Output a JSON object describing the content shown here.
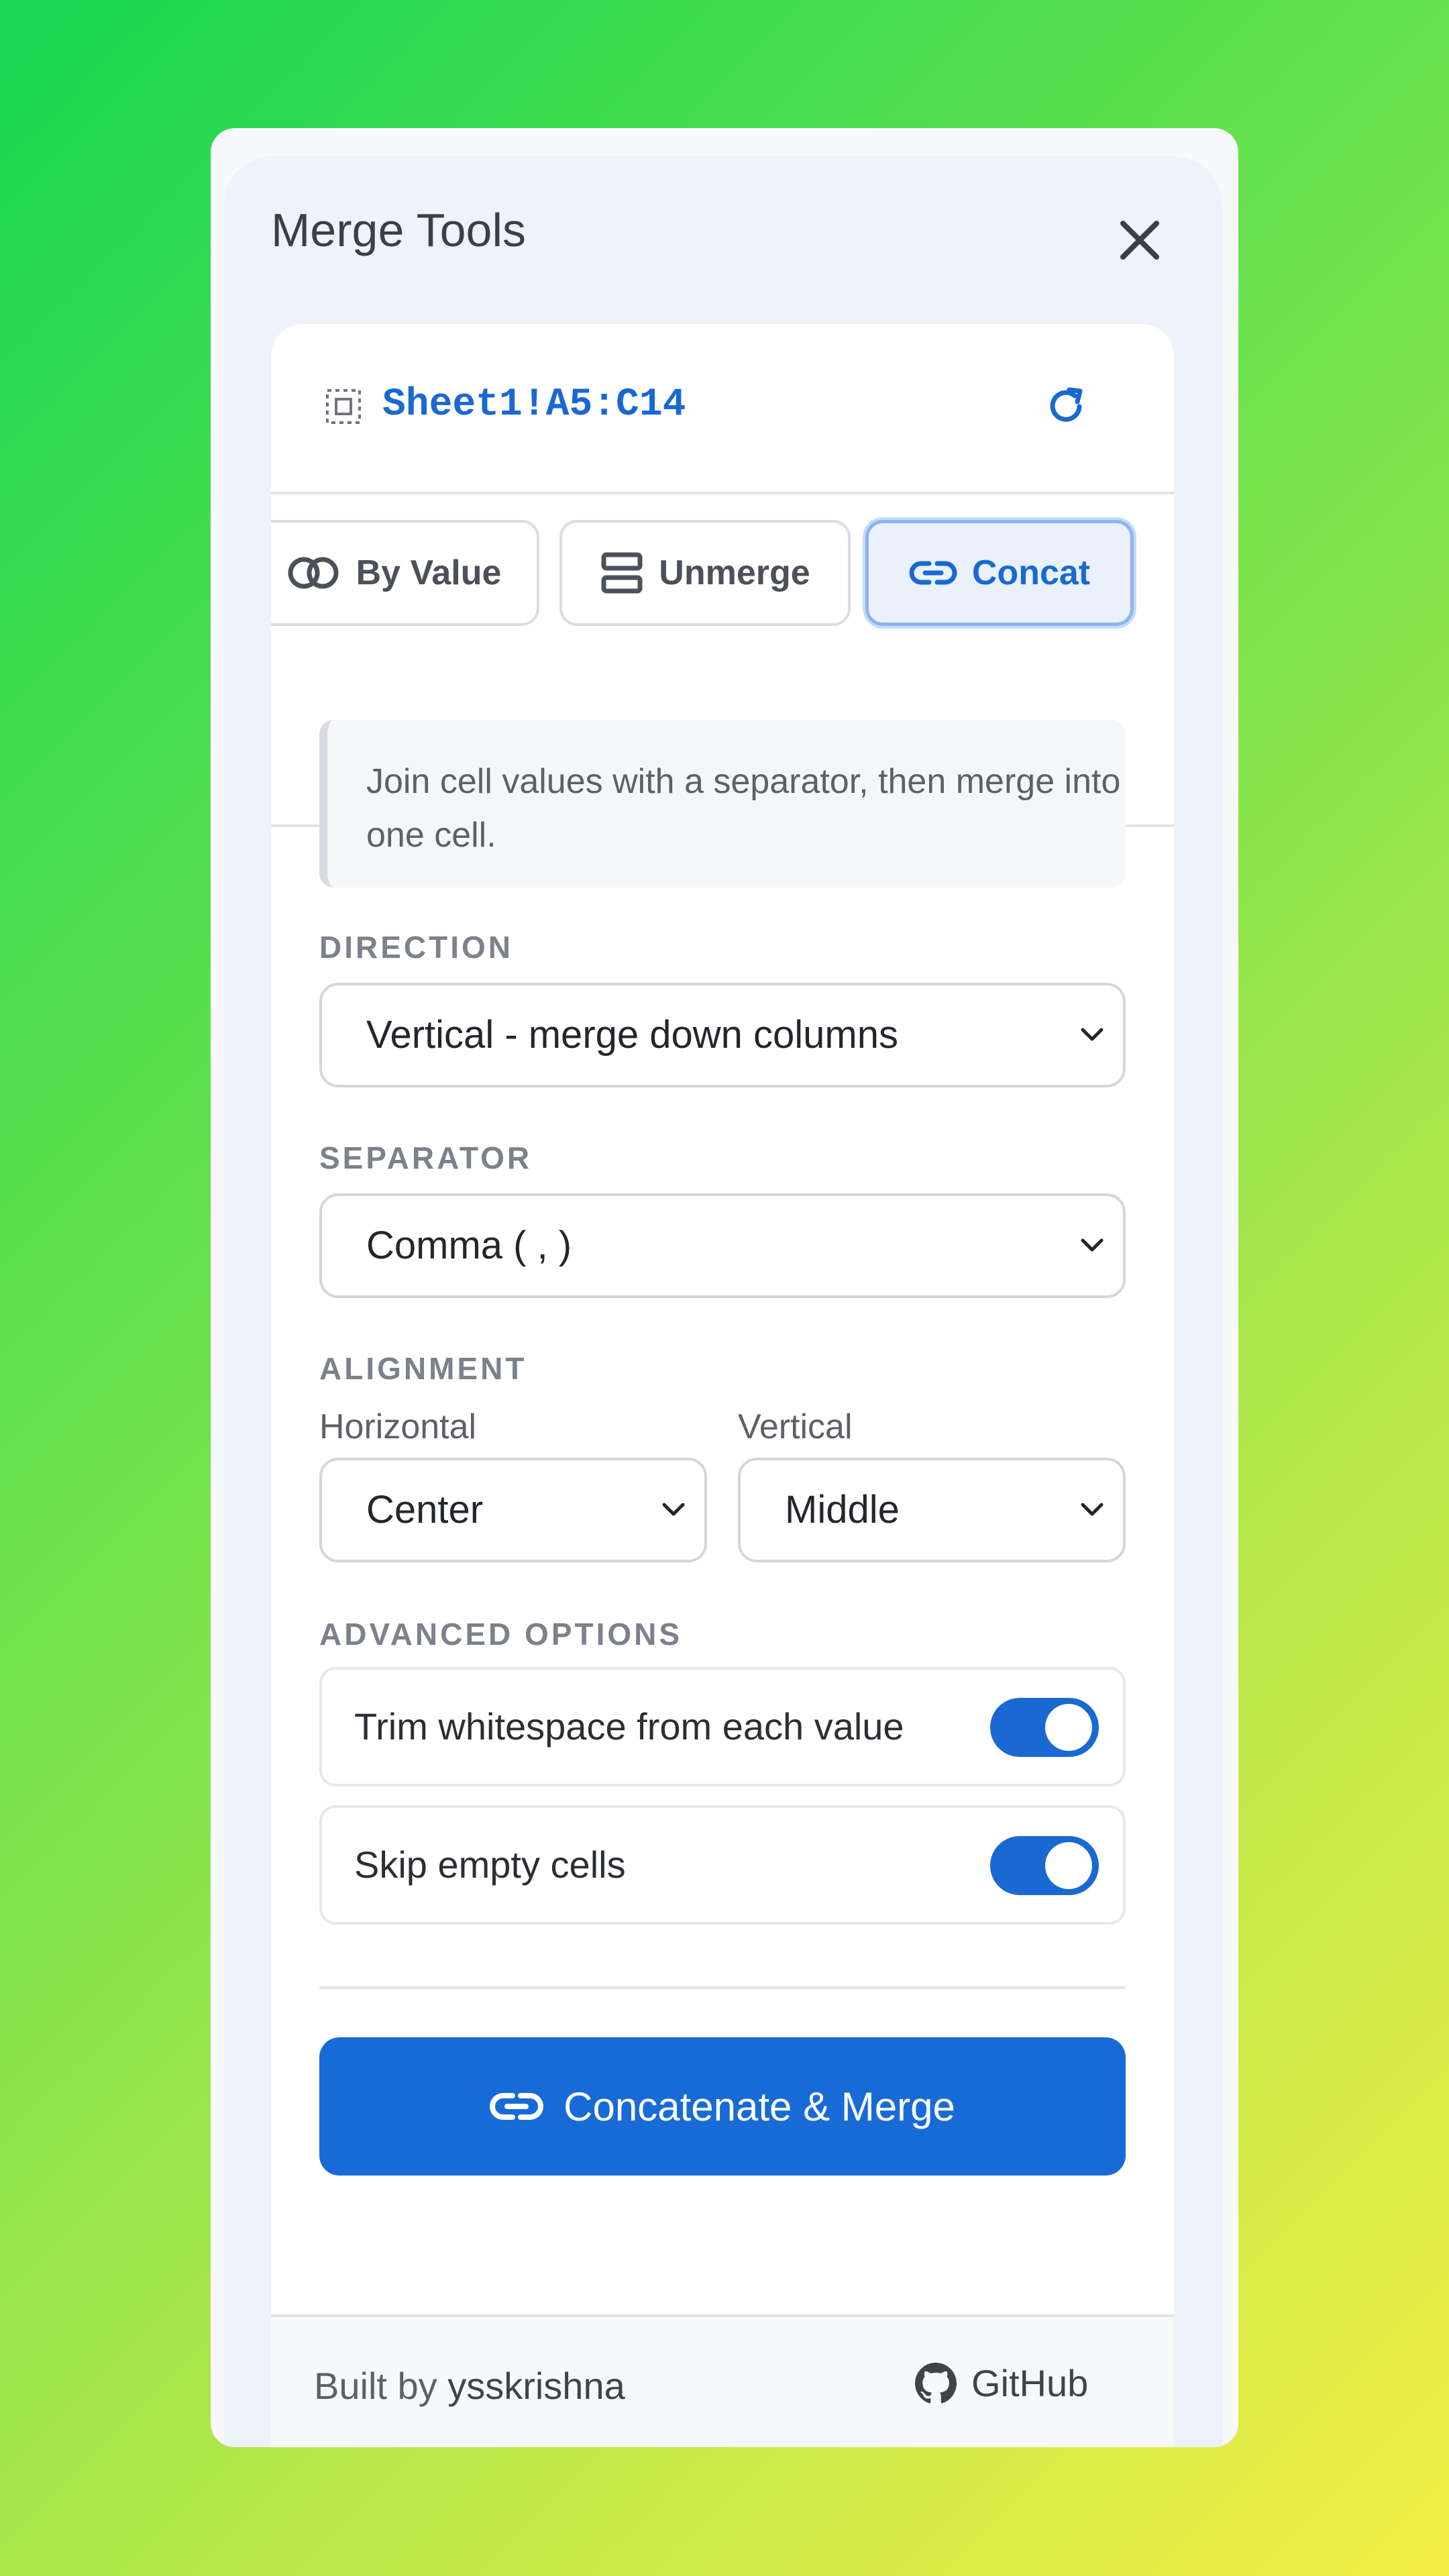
{
  "header": {
    "title": "Merge Tools"
  },
  "range": {
    "address": "Sheet1!A5:C14"
  },
  "tabs": [
    {
      "label": "By Value",
      "icon": "merge-circles-icon"
    },
    {
      "label": "Unmerge",
      "icon": "split-rows-icon"
    },
    {
      "label": "Concat",
      "icon": "link-icon",
      "active": true
    }
  ],
  "info": {
    "text": "Join cell values with a separator, then merge into one cell."
  },
  "direction": {
    "label": "DIRECTION",
    "value": "Vertical - merge down columns"
  },
  "separator": {
    "label": "SEPARATOR",
    "value": "Comma ( , )"
  },
  "alignment": {
    "label": "ALIGNMENT",
    "horizontal_label": "Horizontal",
    "horizontal_value": "Center",
    "vertical_label": "Vertical",
    "vertical_value": "Middle"
  },
  "advanced": {
    "label": "ADVANCED OPTIONS",
    "options": [
      {
        "label": "Trim whitespace from each value",
        "enabled": true
      },
      {
        "label": "Skip empty cells",
        "enabled": true
      }
    ]
  },
  "action": {
    "label": "Concatenate & Merge"
  },
  "footer": {
    "built_prefix": "Built by",
    "author": "ysskrishna",
    "github_label": "GitHub"
  },
  "colors": {
    "accent": "#186bd6",
    "background_start": "#17d653",
    "background_end": "#f2ee44"
  }
}
